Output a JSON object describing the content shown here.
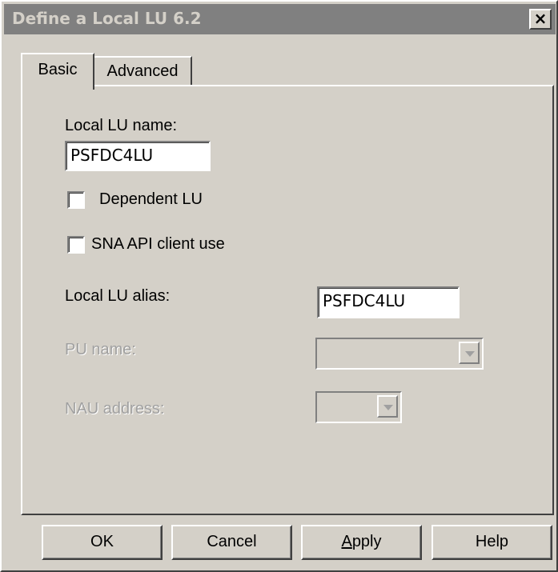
{
  "window": {
    "title": "Define a Local LU 6.2",
    "close_glyph": "×"
  },
  "tabs": [
    {
      "label": "Basic",
      "selected": true
    },
    {
      "label": "Advanced",
      "selected": false
    }
  ],
  "form": {
    "local_lu_name_label": "Local LU name:",
    "local_lu_name_value": "PSFDC4LU",
    "dependent_lu_label": "Dependent LU",
    "dependent_lu_checked": false,
    "sna_api_label": "SNA API client use",
    "sna_api_checked": false,
    "local_lu_alias_label": "Local LU alias:",
    "local_lu_alias_value": "PSFDC4LU",
    "pu_name_label": "PU name:",
    "pu_name_value": "",
    "nau_address_label": "NAU address:",
    "nau_address_value": ""
  },
  "buttons": {
    "ok": "OK",
    "cancel": "Cancel",
    "apply_first": "A",
    "apply_rest": "pply",
    "help": "Help"
  },
  "icons": {
    "close": "close-icon",
    "combo_arrow": "chevron-down-icon"
  }
}
